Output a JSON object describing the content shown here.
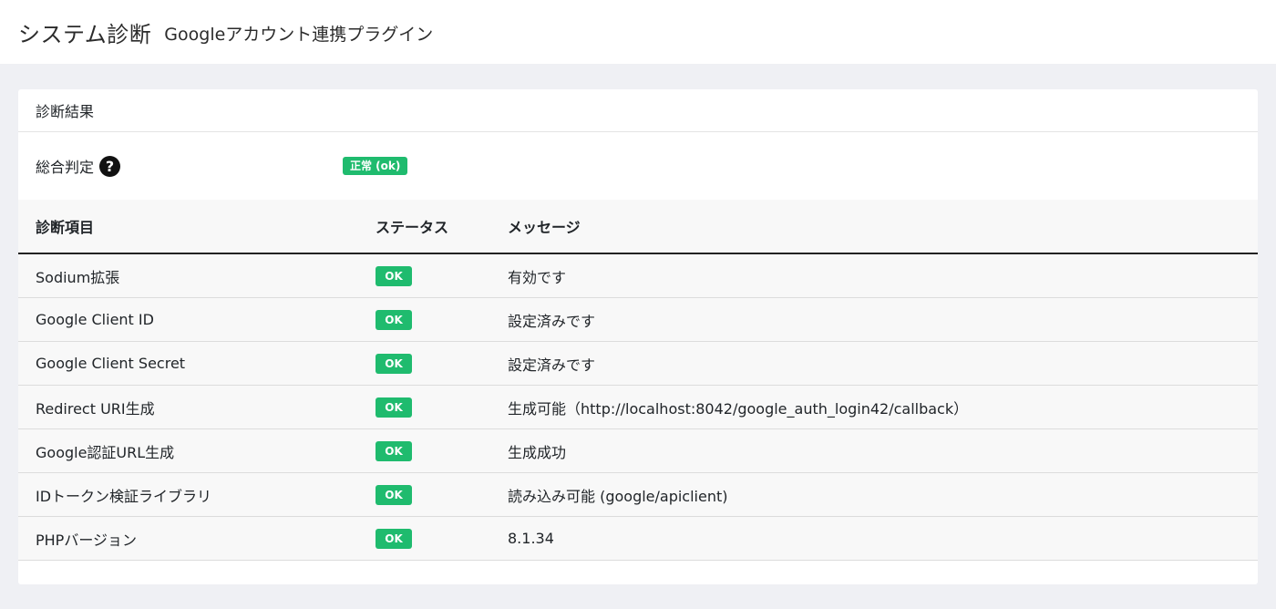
{
  "header": {
    "title": "システム診断",
    "subtitle": "Googleアカウント連携プラグイン"
  },
  "card": {
    "title": "診断結果",
    "overall": {
      "label": "総合判定",
      "help_icon": "?",
      "badge": "正常 (ok)"
    }
  },
  "table": {
    "columns": [
      "診断項目",
      "ステータス",
      "メッセージ"
    ],
    "rows": [
      {
        "item": "Sodium拡張",
        "status": "OK",
        "message": "有効です"
      },
      {
        "item": "Google Client ID",
        "status": "OK",
        "message": "設定済みです"
      },
      {
        "item": "Google Client Secret",
        "status": "OK",
        "message": "設定済みです"
      },
      {
        "item": "Redirect URI生成",
        "status": "OK",
        "message": "生成可能（http://localhost:8042/google_auth_login42/callback）"
      },
      {
        "item": "Google認証URL生成",
        "status": "OK",
        "message": "生成成功"
      },
      {
        "item": "IDトークン検証ライブラリ",
        "status": "OK",
        "message": "読み込み可能 (google/apiclient)"
      },
      {
        "item": "PHPバージョン",
        "status": "OK",
        "message": "8.1.34"
      }
    ]
  },
  "colors": {
    "ok_badge": "#1fbb6e",
    "background": "#eff0f4"
  }
}
